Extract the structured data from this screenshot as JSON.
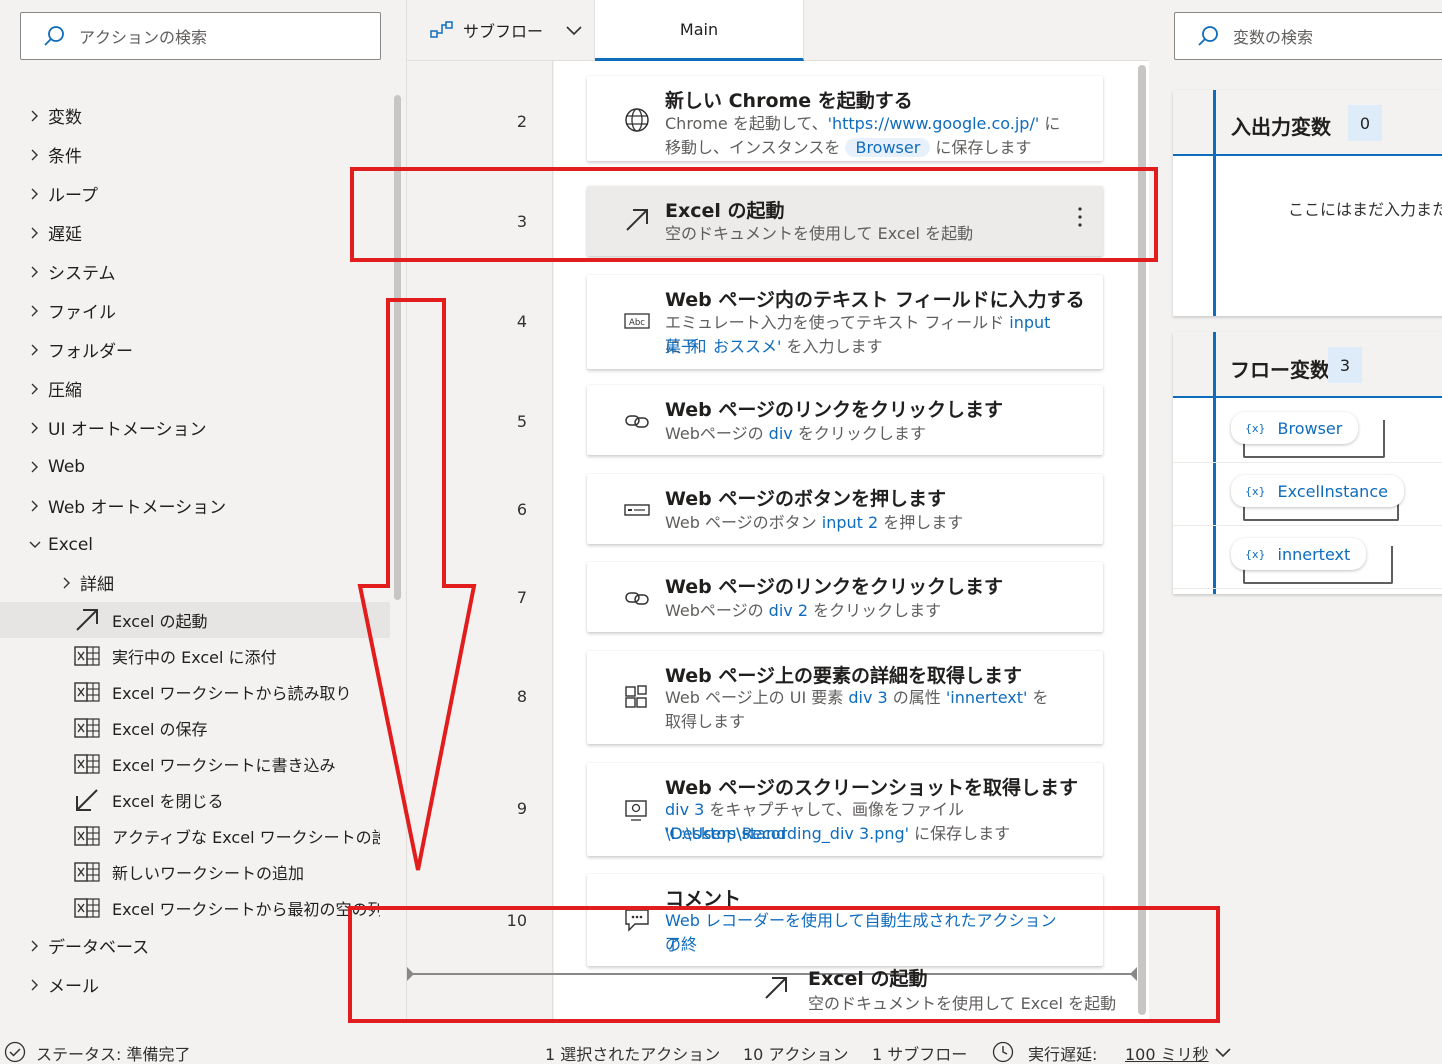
{
  "left_panel": {
    "search_placeholder": "アクションの検索",
    "categories": [
      {
        "label": "変数"
      },
      {
        "label": "条件"
      },
      {
        "label": "ループ"
      },
      {
        "label": "遅延"
      },
      {
        "label": "システム"
      },
      {
        "label": "ファイル"
      },
      {
        "label": "フォルダー"
      },
      {
        "label": "圧縮"
      },
      {
        "label": "UI オートメーション"
      },
      {
        "label": "Web"
      },
      {
        "label": "Web オートメーション"
      },
      {
        "label": "Excel"
      }
    ],
    "excel_sub": {
      "label": "詳細"
    },
    "excel_actions": [
      {
        "label": "Excel の起動",
        "icon": "arrow-up-right-icon"
      },
      {
        "label": "実行中の Excel に添付",
        "icon": "excel-icon"
      },
      {
        "label": "Excel ワークシートから読み取り",
        "icon": "excel-icon"
      },
      {
        "label": "Excel の保存",
        "icon": "excel-icon"
      },
      {
        "label": "Excel ワークシートに書き込み",
        "icon": "excel-icon"
      },
      {
        "label": "Excel を閉じる",
        "icon": "arrow-down-left-icon"
      },
      {
        "label": "アクティブな Excel ワークシートの設定",
        "icon": "excel-icon"
      },
      {
        "label": "新しいワークシートの追加",
        "icon": "excel-icon"
      },
      {
        "label": "Excel ワークシートから最初の空の列…",
        "icon": "excel-icon"
      }
    ],
    "after_categories": [
      {
        "label": "データベース"
      },
      {
        "label": "メール"
      }
    ]
  },
  "tabs": {
    "subflow_label": "サブフロー",
    "main_label": "Main"
  },
  "flow": {
    "steps": [
      {
        "num": "2",
        "title": "新しい Chrome を起動する",
        "icon": "globe-icon",
        "desc1": "Chrome を起動して、",
        "desc1_v": "'https://www.google.co.jp/'",
        "desc1_after": " に",
        "desc2": "移動し、インスタンスを",
        "desc2_pill": "Browser",
        "desc2_after": " に保存します"
      },
      {
        "num": "3",
        "title": "Excel の起動",
        "icon": "arrow-up-right-icon",
        "desc": "空のドキュメントを使用して Excel を起動"
      },
      {
        "num": "4",
        "title": "Web ページ内のテキスト フィールドに入力する",
        "icon": "textbox-icon",
        "desc1": "エミュレート入力を使ってテキスト フィールド ",
        "desc1_v": "input",
        "desc1_after": " に ",
        "desc1_v2": "'和",
        "desc2_v": "菓子　おススメ'",
        "desc2_after": " を入力します"
      },
      {
        "num": "5",
        "title": "Web ページのリンクをクリックします",
        "icon": "link-icon",
        "desc_a": "Webページの ",
        "desc_v": "div",
        "desc_b": " をクリックします"
      },
      {
        "num": "6",
        "title": "Web ページのボタンを押します",
        "icon": "button-icon",
        "desc_a": "Web ページのボタン ",
        "desc_v": "input 2",
        "desc_b": " を押します"
      },
      {
        "num": "7",
        "title": "Web ページのリンクをクリックします",
        "icon": "link-icon",
        "desc_a": "Webページの ",
        "desc_v": "div 2",
        "desc_b": " をクリックします"
      },
      {
        "num": "8",
        "title": "Web ページ上の要素の詳細を取得します",
        "icon": "element-icon",
        "desc1": "Web ページ上の UI 要素 ",
        "desc1_v": "div 3",
        "desc1_after": " の属性 ",
        "desc1_v2": "'innertext'",
        "desc1_after2": " を",
        "desc2": "取得します"
      },
      {
        "num": "9",
        "title": "Web ページのスクリーンショットを取得します",
        "icon": "screenshot-icon",
        "desc1_v": "div 3",
        "desc1_after": " をキャプチャして、画像をファイル ",
        "desc1_v2": "'C:\\Users\\stand",
        "desc2_v": "\\Desktop\\Recording_div 3.png'",
        "desc2_after": " に保存します"
      },
      {
        "num": "10",
        "title": "コメント",
        "icon": "comment-icon",
        "desc1_v": "Web レコーダーを使用して自動生成されたアクションの終",
        "desc2_v": "了"
      }
    ],
    "drag_ghost": {
      "title": "Excel の起動",
      "desc": "空のドキュメントを使用して Excel を起動"
    }
  },
  "right_panel": {
    "search_placeholder": "変数の検索",
    "io_vars": {
      "title": "入出力変数",
      "count": "0",
      "empty": "ここにはまだ入力また"
    },
    "flow_vars": {
      "title": "フロー変数",
      "count": "3",
      "items": [
        {
          "name": "Browser"
        },
        {
          "name": "ExcelInstance"
        },
        {
          "name": "innertext"
        }
      ]
    },
    "var_prefix": "{x}"
  },
  "status_bar": {
    "status": "ステータス: 準備完了",
    "selected": "1 選択されたアクション",
    "actions": "10 アクション",
    "subflows": "1 サブフロー",
    "delay_label": "実行遅延:",
    "delay_value": "100 ミリ秒"
  },
  "colors": {
    "accent": "#0f6cbd",
    "annotation": "#e21d1d"
  }
}
